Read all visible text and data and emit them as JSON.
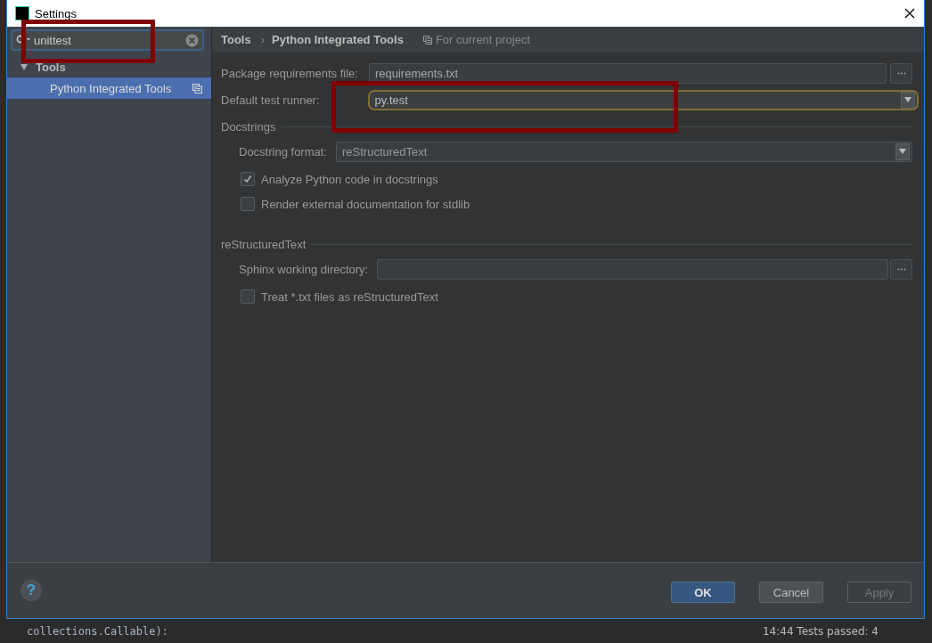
{
  "window": {
    "title": "Settings"
  },
  "search": {
    "value": "unittest",
    "highlight": true
  },
  "sidebar": {
    "items": [
      {
        "label": "Tools",
        "expanded": true,
        "selected": false,
        "children": [
          {
            "label": "Python Integrated Tools",
            "selected": true
          }
        ]
      }
    ]
  },
  "breadcrumb": [
    "Tools",
    "Python Integrated Tools"
  ],
  "breadcrumb_separator": "›",
  "help_button": "?",
  "scope_note": "For current project",
  "fields": [
    {
      "kind": "browse",
      "label": "Package requirements file:",
      "value": "requirements.txt",
      "highlight": false,
      "focused": false,
      "indent": false
    },
    {
      "kind": "combo",
      "label": "Default test runner:",
      "value": "py.test",
      "highlight": true,
      "focused": true,
      "indent": false
    }
  ],
  "sections": [
    {
      "title": "Docstrings",
      "rows": [
        {
          "kind": "combo",
          "label": "Docstring format:",
          "value": "reStructuredText",
          "highlight": false,
          "focused": false,
          "indent": true
        },
        {
          "kind": "checkbox",
          "label": "Analyze Python code in docstrings",
          "checked": true
        },
        {
          "kind": "checkbox",
          "label": "Render external documentation for stdlib",
          "checked": false
        }
      ]
    },
    {
      "title": "reStructuredText",
      "rows": [
        {
          "kind": "browse",
          "label": "Sphinx working directory:",
          "highlight": false,
          "focused": false,
          "indent": true
        },
        {
          "kind": "checkbox",
          "label": "Treat *.txt files as reStructuredText",
          "checked": false
        }
      ]
    }
  ],
  "buttons": [
    {
      "label": "OK",
      "kind": "default",
      "disabled": false
    },
    {
      "label": "Cancel",
      "kind": "normal",
      "disabled": false
    },
    {
      "label": "Apply",
      "kind": "normal",
      "disabled": true
    }
  ],
  "background": {
    "code_line": "collections.Callable):",
    "status": "14:44 Tests passed: 4"
  }
}
